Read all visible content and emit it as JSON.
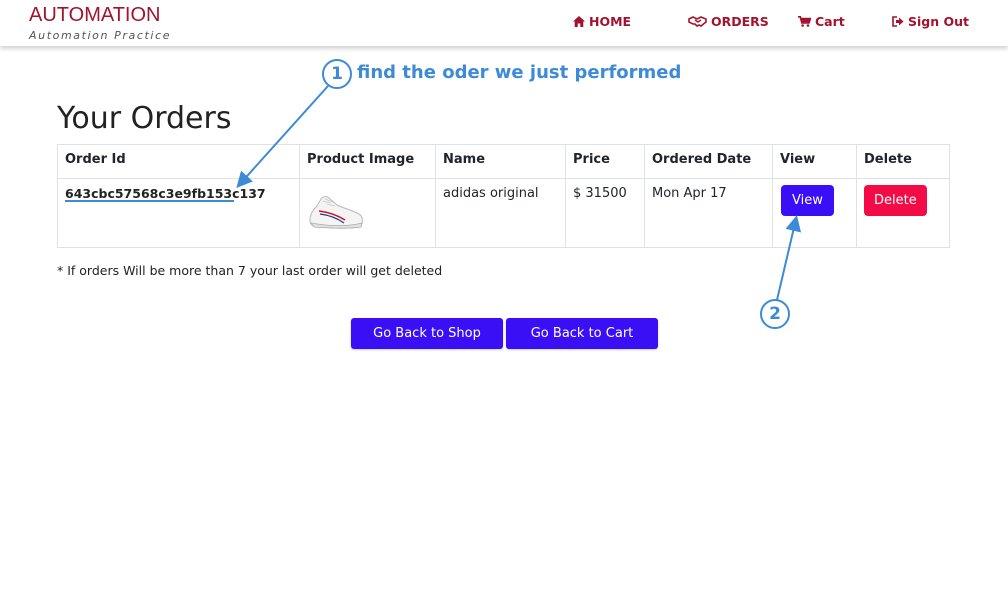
{
  "brand": {
    "title": "AUTOMATION",
    "subtitle": "Automation Practice"
  },
  "nav": {
    "home": "HOME",
    "orders": "ORDERS",
    "cart": "Cart",
    "signout": "Sign Out"
  },
  "annotations": {
    "step1_number": "1",
    "step1_text": "find the oder we just performed",
    "step2_number": "2",
    "color": "#3d8ad6"
  },
  "page": {
    "title": "Your Orders"
  },
  "table": {
    "headers": [
      "Order Id",
      "Product Image",
      "Name",
      "Price",
      "Ordered Date",
      "View",
      "Delete"
    ],
    "rows": [
      {
        "order_id": "643cbc57568c3e9fb153c137",
        "image": "white-sneaker-image",
        "name": "adidas original",
        "price": "$ 31500",
        "date": "Mon Apr 17",
        "view_label": "View",
        "delete_label": "Delete"
      }
    ]
  },
  "note": "* If orders Will be more than 7 your last order will get deleted",
  "buttons": {
    "back_shop": "Go Back to Shop",
    "back_cart": "Go Back to Cart"
  },
  "colors": {
    "brand": "#a3122e",
    "primary": "#3b0ff5",
    "danger": "#f20b46"
  }
}
